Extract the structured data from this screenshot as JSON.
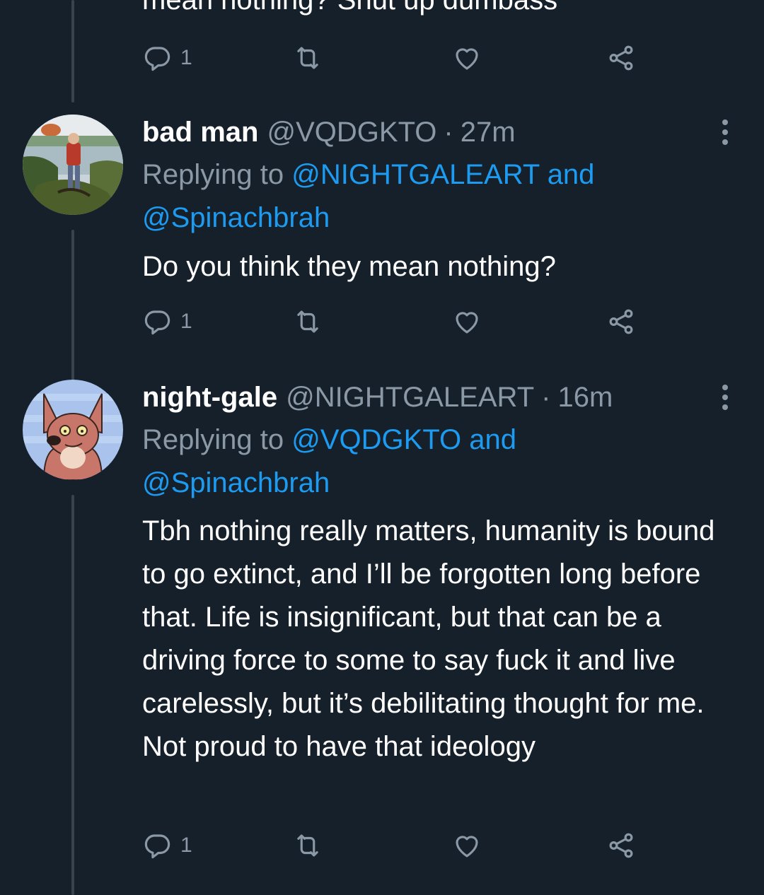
{
  "previous_tweet": {
    "partial_text": "mean nothing? Shut up dumbass",
    "actions": {
      "reply_count": "1"
    }
  },
  "tweets": [
    {
      "display_name": "bad man",
      "handle": "@VQDGKTO",
      "separator": "·",
      "time": "27m",
      "replying_prefix": "Replying to",
      "replying_user1": "@NIGHTGALEART",
      "replying_and": "and",
      "replying_user2": "@Spinachbrah",
      "text": "Do you think they mean nothing?",
      "reply_count": "1"
    },
    {
      "display_name": "night-gale",
      "handle": "@NIGHTGALEART",
      "separator": "·",
      "time": "16m",
      "replying_prefix": "Replying to",
      "replying_user1": "@VQDGKTO",
      "replying_and": "and",
      "replying_user2": "@Spinachbrah",
      "text": "Tbh nothing really matters, humanity is bound to go extinct, and I’ll be forgotten long before that. Life is insignificant, but that can be a driving force to some to say fuck it and live carelessly, but it’s debilitating thought for me. Not proud to have that ideology",
      "reply_count": "1"
    }
  ],
  "icons": {
    "reply": "reply-icon",
    "retweet": "retweet-icon",
    "like": "heart-icon",
    "share": "share-icon",
    "more": "more-options-icon"
  },
  "colors": {
    "background": "#15202b",
    "secondary_text": "#8b98a5",
    "link": "#1d9bf0",
    "thread_line": "#38444d"
  }
}
